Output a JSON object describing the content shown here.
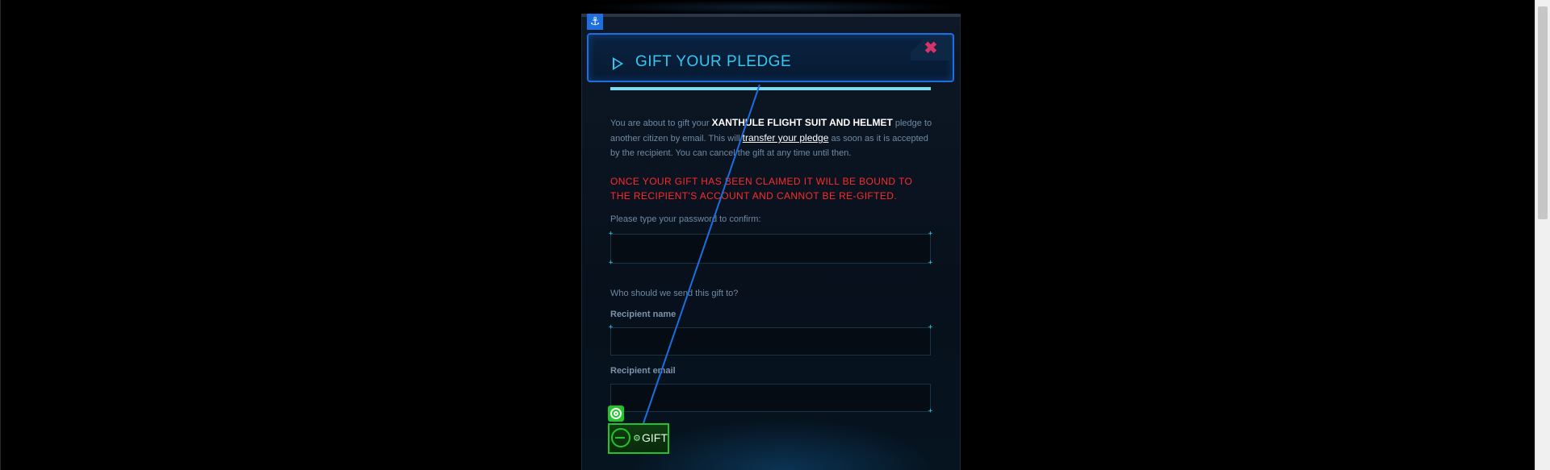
{
  "modal": {
    "title": "GIFT YOUR PLEDGE",
    "close_glyph": "✖",
    "intro_before": "You are about to gift your",
    "item_name": "XANTHULE FLIGHT SUIT AND HELMET",
    "intro_middle": "pledge to another citizen by email. This will",
    "link_text": "transfer your pledge",
    "intro_after": "as soon as it is accepted by the recipient. You can cancel the gift at any time until then.",
    "warning": "ONCE YOUR GIFT HAS BEEN CLAIMED IT WILL BE BOUND TO THE RECIPIENT'S ACCOUNT AND CANNOT BE RE-GIFTED.",
    "password_prompt": "Please type your password to confirm:",
    "password_value": "",
    "recipient_prompt": "Who should we send this gift to?",
    "recipient_name_label": "Recipient name",
    "recipient_name_value": "",
    "recipient_email_label": "Recipient email",
    "recipient_email_value": "",
    "gift_button_label": "GIFT"
  },
  "overlay": {
    "anchor_icon": "anchor-icon",
    "target_icon": "target-icon",
    "anchor_glyph": "⚓"
  },
  "colors": {
    "accent": "#35c7f2",
    "header_border": "#1b6fe0",
    "warning": "#ff2b2b",
    "gift_button": "#22c42a",
    "close": "#d6336c"
  }
}
